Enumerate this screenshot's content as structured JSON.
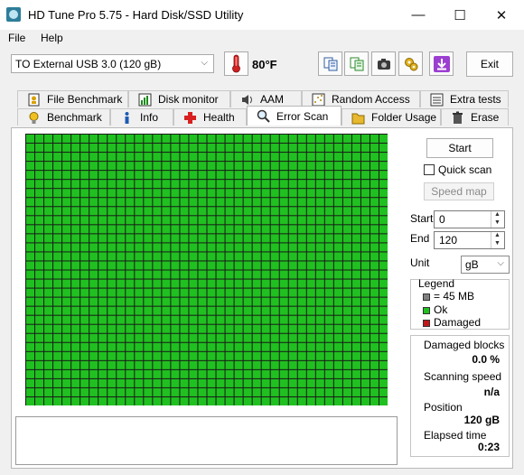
{
  "window": {
    "title": "HD Tune Pro 5.75 - Hard Disk/SSD Utility",
    "minimize": "—",
    "maximize": "☐",
    "close": "✕"
  },
  "menu": {
    "file": "File",
    "help": "Help"
  },
  "toolbar": {
    "drive": "TO External USB 3.0 (120 gB)",
    "temperature": "80°F",
    "exit_label": "Exit"
  },
  "tabs": {
    "row1": [
      "File Benchmark",
      "Disk monitor",
      "AAM",
      "Random Access",
      "Extra tests"
    ],
    "row2": [
      "Benchmark",
      "Info",
      "Health",
      "Error Scan",
      "Folder Usage",
      "Erase"
    ],
    "active": "Error Scan"
  },
  "scan_grid": {
    "columns": 40,
    "rows": 30,
    "status": "Ok",
    "ok_color": "#20c020",
    "border_color": "#1a1a1a"
  },
  "controls": {
    "start_label": "Start",
    "quick_scan_label": "Quick scan",
    "quick_scan_checked": false,
    "speed_map_label": "Speed map",
    "start_field_label": "Start",
    "start_value": "0",
    "end_field_label": "End",
    "end_value": "120",
    "unit_label": "Unit",
    "unit_value": "gB"
  },
  "legend": {
    "title": "Legend",
    "items": [
      {
        "label": "= 45 MB",
        "color": "#808080"
      },
      {
        "label": "Ok",
        "color": "#20c020"
      },
      {
        "label": "Damaged",
        "color": "#c01818"
      }
    ]
  },
  "stats": {
    "damaged_blocks_label": "Damaged blocks",
    "damaged_blocks_value": "0.0 %",
    "scanning_speed_label": "Scanning speed",
    "scanning_speed_value": "n/a",
    "position_label": "Position",
    "position_value": "120 gB",
    "elapsed_label": "Elapsed time",
    "elapsed_value": "0:23"
  }
}
